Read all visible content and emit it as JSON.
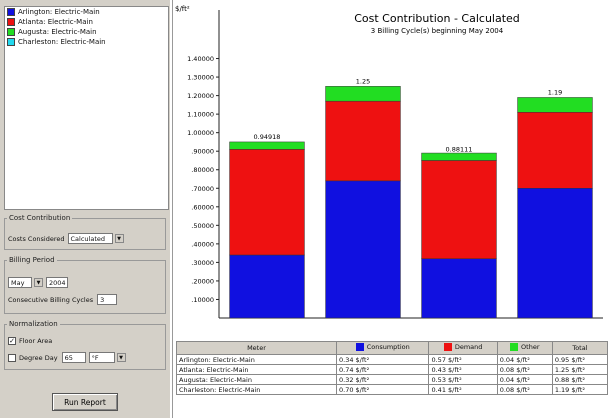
{
  "meters": [
    {
      "label": "Arlington: Electric-Main",
      "color": "#1010e0"
    },
    {
      "label": "Atlanta: Electric-Main",
      "color": "#ee1111"
    },
    {
      "label": "Augusta: Electric-Main",
      "color": "#22dd22"
    },
    {
      "label": "Charleston: Electric-Main",
      "color": "#22d8ee"
    }
  ],
  "cost_contribution": {
    "legend": "Cost Contribution",
    "costs_considered_label": "Costs Considered",
    "costs_considered_value": "Calculated"
  },
  "billing_period": {
    "legend": "Billing Period",
    "month": "May",
    "year": "2004",
    "consecutive_label": "Consecutive Billing Cycles",
    "consecutive_value": "3"
  },
  "normalization": {
    "legend": "Normalization",
    "floor_area_label": "Floor Area",
    "floor_area_checked": "✓",
    "degree_day_label": "Degree Day",
    "degree_day_value": "65",
    "degree_unit": "°F"
  },
  "run_report_label": "Run Report",
  "chart_data": {
    "type": "bar",
    "stacked": true,
    "title": "Cost Contribution - Calculated",
    "subtitle": "3 Billing Cycle(s) beginning May 2004",
    "ylabel": "$/ft²",
    "ylim": [
      0,
      1.5
    ],
    "ticks": [
      ".10000",
      ".20000",
      ".30000",
      ".40000",
      ".50000",
      ".60000",
      ".70000",
      ".80000",
      ".90000",
      "1.00000",
      "1.10000",
      "1.20000",
      "1.30000",
      "1.40000"
    ],
    "tick_values": [
      0.1,
      0.2,
      0.3,
      0.4,
      0.5,
      0.6,
      0.7,
      0.8,
      0.9,
      1.0,
      1.1,
      1.2,
      1.3,
      1.4
    ],
    "categories": [
      "Arlington: Electric-Main",
      "Atlanta: Electric-Main",
      "Augusta: Electric-Main",
      "Charleston: Electric-Main"
    ],
    "series": [
      {
        "name": "Consumption",
        "color": "#1010e0",
        "values": [
          0.34,
          0.74,
          0.32,
          0.7
        ]
      },
      {
        "name": "Demand",
        "color": "#ee1111",
        "values": [
          0.57,
          0.43,
          0.53,
          0.41
        ]
      },
      {
        "name": "Other",
        "color": "#22dd22",
        "values": [
          0.04,
          0.08,
          0.04,
          0.08
        ]
      }
    ],
    "totals_labels": [
      "0.94918",
      "1.25",
      "0.88111",
      "1.19"
    ],
    "totals": [
      0.94918,
      1.25,
      0.88111,
      1.19
    ],
    "grid": false
  },
  "table": {
    "headers": [
      "Meter",
      "Consumption",
      "Demand",
      "Other",
      "Total"
    ],
    "rows": [
      [
        "Arlington: Electric-Main",
        "0.34 $/ft²",
        "0.57 $/ft²",
        "0.04 $/ft²",
        "0.95 $/ft²"
      ],
      [
        "Atlanta: Electric-Main",
        "0.74 $/ft²",
        "0.43 $/ft²",
        "0.08 $/ft²",
        "1.25 $/ft²"
      ],
      [
        "Augusta: Electric-Main",
        "0.32 $/ft²",
        "0.53 $/ft²",
        "0.04 $/ft²",
        "0.88 $/ft²"
      ],
      [
        "Charleston: Electric-Main",
        "0.70 $/ft²",
        "0.41 $/ft²",
        "0.08 $/ft²",
        "1.19 $/ft²"
      ]
    ]
  }
}
